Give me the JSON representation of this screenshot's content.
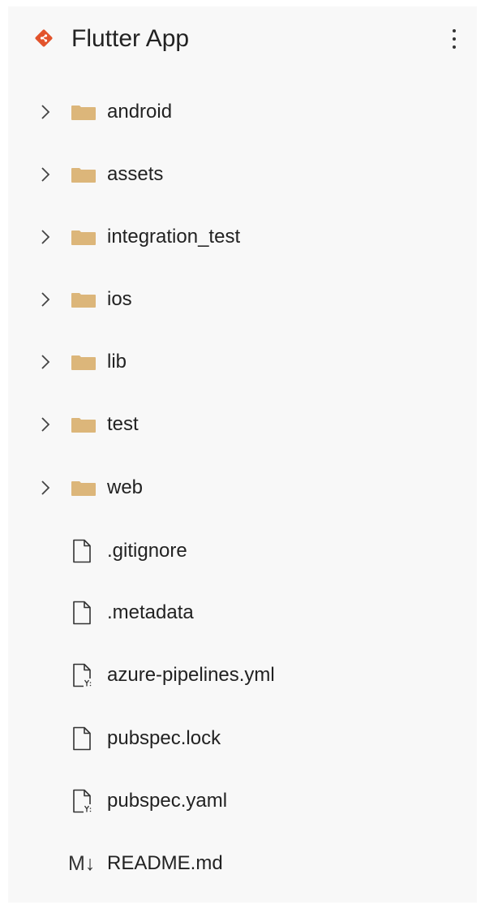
{
  "header": {
    "title": "Flutter App",
    "icon": "git-repo-icon",
    "more_icon": "more-vertical-icon"
  },
  "colors": {
    "panel_bg": "#f8f8f8",
    "git_icon": "#e2532c",
    "folder": "#dcb67a",
    "text": "#222222"
  },
  "items": [
    {
      "type": "folder",
      "label": "android"
    },
    {
      "type": "folder",
      "label": "assets"
    },
    {
      "type": "folder",
      "label": "integration_test"
    },
    {
      "type": "folder",
      "label": "ios"
    },
    {
      "type": "folder",
      "label": "lib"
    },
    {
      "type": "folder",
      "label": "test"
    },
    {
      "type": "folder",
      "label": "web"
    },
    {
      "type": "file",
      "label": ".gitignore"
    },
    {
      "type": "file",
      "label": ".metadata"
    },
    {
      "type": "yaml-file",
      "label": "azure-pipelines.yml"
    },
    {
      "type": "file",
      "label": "pubspec.lock"
    },
    {
      "type": "yaml-file",
      "label": "pubspec.yaml"
    },
    {
      "type": "markdown-file",
      "label": "README.md",
      "icon_text": "M↓"
    }
  ]
}
